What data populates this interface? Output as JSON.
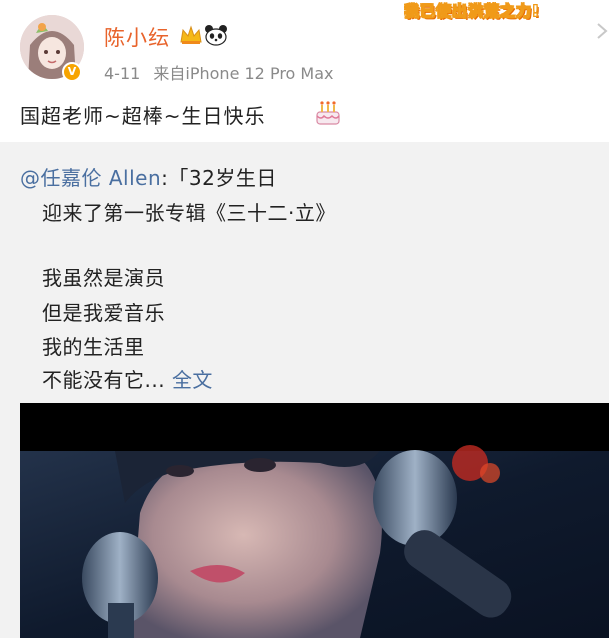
{
  "header": {
    "username": "陈小纭",
    "time": "4-11",
    "source": "来自iPhone 12 Pro Max",
    "sticker": "我已使出洪荒之力!"
  },
  "post": {
    "text": "国超老师~超棒~生日快乐"
  },
  "repost": {
    "mention": "@任嘉伦 Allen",
    "line1": ":「32岁生日",
    "line2": "迎来了第一张专辑《三十二·立》",
    "line3": "我虽然是演员",
    "line4": "但是我爱音乐",
    "line5": "我的生活里",
    "line6": "不能没有它...",
    "more": "全文"
  },
  "colors": {
    "username": "#e8632b",
    "link": "#4a6fa0",
    "repost_bg": "#f2f2f2",
    "badge": "#f7a400"
  },
  "icons": [
    "crown-icon",
    "panda-icon",
    "cake-icon",
    "verified-badge-icon",
    "arrow-right-icon"
  ]
}
